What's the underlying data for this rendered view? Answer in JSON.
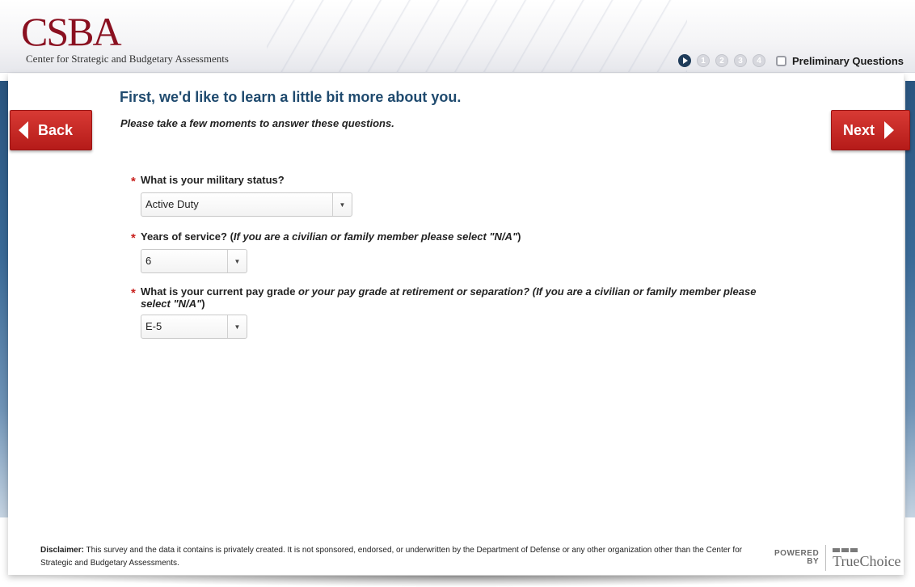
{
  "header": {
    "logo": "CSBA",
    "org_name": "Center for Strategic and Budgetary Assessments",
    "progress": {
      "steps": [
        "1",
        "2",
        "3",
        "4"
      ],
      "current_label": "Preliminary Questions"
    }
  },
  "main": {
    "heading": "First, we'd like to learn a little bit more about you.",
    "subheading": "Please take a few moments to answer these questions.",
    "questions": [
      {
        "text": "What is your military status?",
        "italic": "",
        "suffix": "",
        "value": "Active Duty",
        "required_mark": "*"
      },
      {
        "text": "Years of service? (",
        "italic": "If you are a civilian or family member please select \"N/A\"",
        "suffix": ")",
        "value": "6",
        "required_mark": "*"
      },
      {
        "text": "What is your current pay grade ",
        "italic": "or your pay grade at retirement or separation? (If you are a civilian or family member please select \"N/A\"",
        "suffix": ")",
        "value": "E-5",
        "required_mark": "*"
      }
    ]
  },
  "nav": {
    "back_label": "Back",
    "next_label": "Next"
  },
  "footer": {
    "disclaimer_label": "Disclaimer:",
    "disclaimer_text": " This survey and the data it contains is privately created. It is not sponsored, endorsed, or underwritten by the Department of Defense or any other organization other than the Center for Strategic and Budgetary Assessments.",
    "powered_line1": "POWERED",
    "powered_line2": "BY",
    "brand": "TrueChoice"
  },
  "colors": {
    "brand_red": "#8a1020",
    "button_red": "#c62a26",
    "heading_blue": "#1f4a6e",
    "side_band_blue": "#2a5580"
  },
  "icons": {
    "progress_current": "play-circle-icon",
    "progress_checkbox": "checkbox-icon",
    "select_arrow": "triangle-down-icon",
    "back_arrow": "triangle-left-icon",
    "next_arrow": "triangle-right-icon"
  }
}
